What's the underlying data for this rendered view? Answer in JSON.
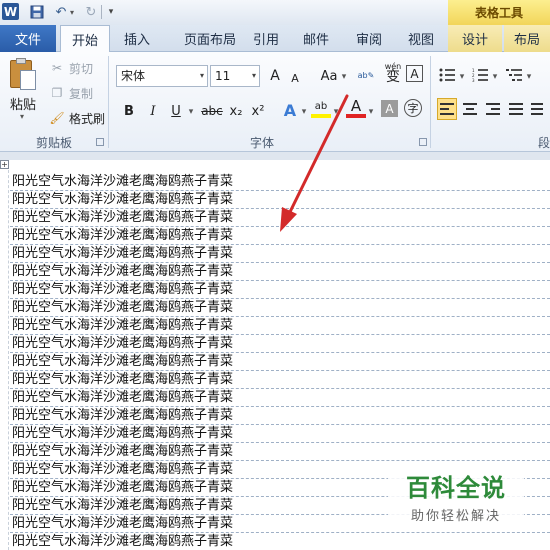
{
  "titlebar": {
    "app_icon_letter": "W",
    "contextual_header": "表格工具"
  },
  "tabs": [
    {
      "label": "文件"
    },
    {
      "label": "开始"
    },
    {
      "label": "插入"
    },
    {
      "label": "页面布局"
    },
    {
      "label": "引用"
    },
    {
      "label": "邮件"
    },
    {
      "label": "审阅"
    },
    {
      "label": "视图"
    },
    {
      "label": "设计"
    },
    {
      "label": "布局"
    }
  ],
  "ribbon": {
    "clipboard": {
      "paste_label": "粘贴",
      "cut_label": "剪切",
      "copy_label": "复制",
      "format_painter_label": "格式刷",
      "group_label": "剪贴板"
    },
    "font": {
      "font_name": "宋体",
      "font_size": "11",
      "grow_label": "A",
      "shrink_label": "A",
      "change_case_label": "Aa",
      "pinyin_label": "wén",
      "phonetic_char": "变",
      "border_char": "A",
      "bold_label": "B",
      "italic_label": "I",
      "underline_label": "U",
      "strike_label": "abc",
      "subscript_label": "x₂",
      "superscript_label": "x²",
      "text_effects_label": "A",
      "highlight_label": "ab",
      "font_color_label": "A",
      "shading_char": "A",
      "enclose_char": "字",
      "group_label": "字体"
    },
    "paragraph": {
      "group_label": "段"
    }
  },
  "document": {
    "rows": [
      "阳光空气水海洋沙滩老鹰海鸥燕子青菜",
      "阳光空气水海洋沙滩老鹰海鸥燕子青菜",
      "阳光空气水海洋沙滩老鹰海鸥燕子青菜",
      "阳光空气水海洋沙滩老鹰海鸥燕子青菜",
      "阳光空气水海洋沙滩老鹰海鸥燕子青菜",
      "阳光空气水海洋沙滩老鹰海鸥燕子青菜",
      "阳光空气水海洋沙滩老鹰海鸥燕子青菜",
      "阳光空气水海洋沙滩老鹰海鸥燕子青菜",
      "阳光空气水海洋沙滩老鹰海鸥燕子青菜",
      "阳光空气水海洋沙滩老鹰海鸥燕子青菜",
      "阳光空气水海洋沙滩老鹰海鸥燕子青菜",
      "阳光空气水海洋沙滩老鹰海鸥燕子青菜",
      "阳光空气水海洋沙滩老鹰海鸥燕子青菜",
      "阳光空气水海洋沙滩老鹰海鸥燕子青菜",
      "阳光空气水海洋沙滩老鹰海鸥燕子青菜",
      "阳光空气水海洋沙滩老鹰海鸥燕子青菜",
      "阳光空气水海洋沙滩老鹰海鸥燕子青菜",
      "阳光空气水海洋沙滩老鹰海鸥燕子青菜",
      "阳光空气水海洋沙滩老鹰海鸥燕子青菜",
      "阳光空气水海洋沙滩老鹰海鸥燕子青菜",
      "阳光空气水海洋沙滩老鹰海鸥燕子青菜"
    ]
  },
  "watermark": {
    "title": "百科全说",
    "subtitle": "助你轻松解决"
  },
  "colors": {
    "file_tab": "#2a5ca8",
    "contextual_tab": "#f2d55a",
    "annotation_arrow": "#d32a2a",
    "watermark_green": "#2e8a3a"
  },
  "icons": [
    "word-logo-icon",
    "save-icon",
    "undo-icon",
    "redo-icon",
    "paste-icon",
    "cut-icon",
    "copy-icon",
    "format-painter-icon",
    "align-left-icon",
    "align-center-icon",
    "align-right-icon",
    "justify-icon",
    "bullets-icon",
    "numbering-icon",
    "multilevel-list-icon",
    "table-move-handle-icon",
    "annotation-arrow"
  ]
}
